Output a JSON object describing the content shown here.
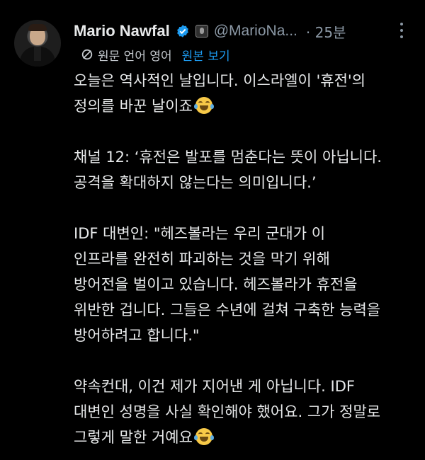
{
  "tweet": {
    "author_name": "Mario Nawfal",
    "handle": "@MarioNa...",
    "timestamp": "· 25분",
    "translate_language": "원문 언어 영어",
    "show_original": "원본 보기",
    "lines": [
      "오늘은 역사적인 날입니다. 이스라엘이 '휴전'의",
      "정의를 바꾼 날이죠",
      "",
      "채널 12: ‘휴전은 발포를 멈춘다는 뜻이 아닙니다.",
      "공격을 확대하지 않는다는 의미입니다.’",
      "",
      "IDF 대변인: \"헤즈볼라는 우리 군대가 이",
      "인프라를 완전히 파괴하는 것을 막기 위해",
      "방어전을 벌이고 있습니다. 헤즈볼라가 휴전을",
      "위반한 겁니다. 그들은 수년에 걸쳐 구축한 능력을",
      "방어하려고 합니다.\"",
      "",
      "약속컨대, 이건 제가 지어낸 게 아닙니다. IDF",
      "대변인 성명을 사실 확인해야 했어요. 그가 정말로",
      "그렇게 말한 거예요"
    ]
  },
  "colors": {
    "background": "#000000",
    "text": "#e7e9ea",
    "muted": "#8b98a5",
    "link": "#1d9bf0",
    "verified": "#1d9bf0"
  },
  "icons": {
    "verified": "verified-badge-icon",
    "affiliation": "affiliate-badge-icon",
    "translate": "translate-icon",
    "more": "more-options-icon",
    "emoji": "face-with-tears-of-joy-emoji"
  }
}
